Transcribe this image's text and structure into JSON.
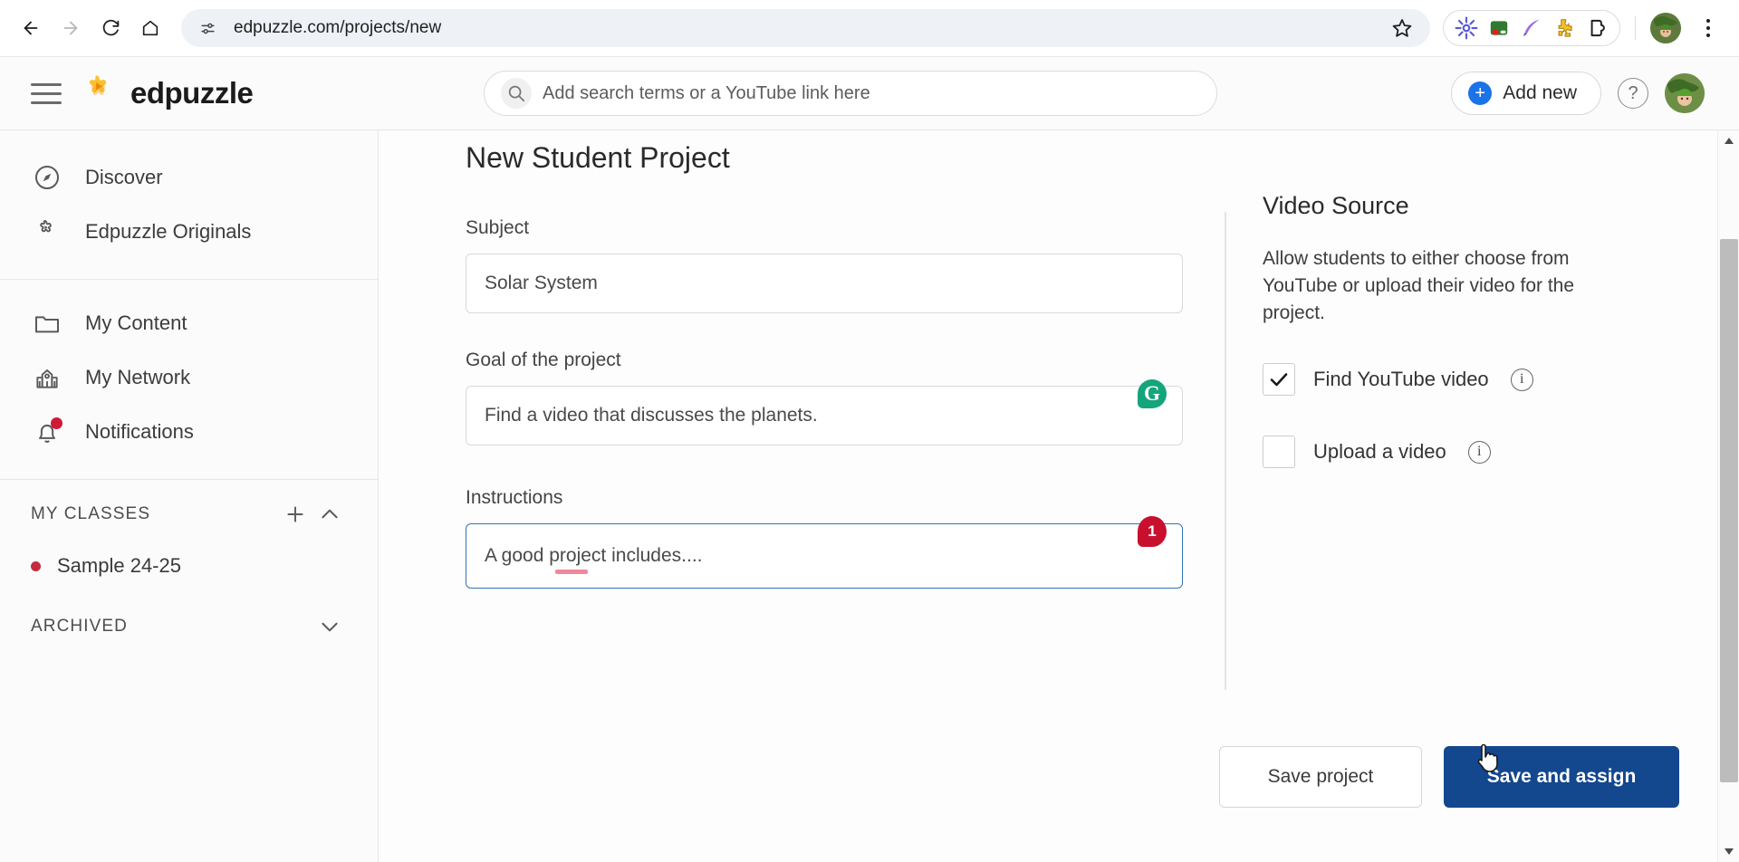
{
  "browser": {
    "back_icon": "back-arrow-icon",
    "forward_icon": "forward-arrow-icon",
    "reload_icon": "reload-icon",
    "home_icon": "home-icon",
    "site_info_icon": "site-settings-icon",
    "url": "edpuzzle.com/projects/new",
    "bookmark_icon": "star-icon",
    "extensions": [
      {
        "name": "extension-asterisk-icon",
        "color": "#5b5bd6"
      },
      {
        "name": "extension-screen-recorder-icon",
        "color": "#2f7a2f"
      },
      {
        "name": "extension-quill-icon",
        "color": "#8a5fd6"
      },
      {
        "name": "extension-puzzle-yellow-icon",
        "color": "#f5c026"
      },
      {
        "name": "extension-manager-icon",
        "color": "#1f1f1f"
      }
    ],
    "profile_icon": "browser-profile-avatar",
    "menu_icon": "three-dot-menu-icon"
  },
  "header": {
    "menu_icon": "hamburger-menu-icon",
    "logo_icon": "edpuzzle-logo-icon",
    "brand": "edpuzzle",
    "search": {
      "icon": "search-icon",
      "placeholder": "Add search terms or a YouTube link here",
      "value": ""
    },
    "add_new_label": "Add new",
    "help_label": "?",
    "avatar_icon": "user-avatar"
  },
  "sidebar": {
    "nav_top": [
      {
        "label": "Discover",
        "icon": "compass-icon"
      },
      {
        "label": "Edpuzzle Originals",
        "icon": "edpuzzle-puzzle-icon"
      }
    ],
    "nav_main": [
      {
        "label": "My Content",
        "icon": "folder-icon"
      },
      {
        "label": "My Network",
        "icon": "school-building-icon"
      },
      {
        "label": "Notifications",
        "icon": "bell-icon",
        "badge": true
      }
    ],
    "my_classes": {
      "title": "MY CLASSES",
      "add_icon": "plus-icon",
      "collapse_icon": "chevron-up-icon",
      "classes": [
        {
          "label": "Sample 24-25",
          "dot_color": "#c42b3f"
        }
      ]
    },
    "archived": {
      "title": "ARCHIVED",
      "expand_icon": "chevron-down-icon"
    }
  },
  "main": {
    "page_title": "New Student Project",
    "fields": [
      {
        "label": "Subject",
        "value": "Solar System",
        "focused": false,
        "badge": null
      },
      {
        "label": "Goal of the project",
        "value": "Find a video that discusses the planets.",
        "focused": false,
        "badge": "grammarly-logo-icon",
        "badge_text": "G"
      },
      {
        "label": "Instructions",
        "value": "A good project includes....",
        "focused": true,
        "badge": "grammarly-issue-count-badge",
        "badge_text": "1"
      }
    ],
    "video_source": {
      "title": "Video Source",
      "description": "Allow students to either choose from YouTube or upload their video for the project.",
      "options": [
        {
          "label": "Find YouTube video",
          "checked": true,
          "info_icon": "info-icon"
        },
        {
          "label": "Upload a video",
          "checked": false,
          "info_icon": "info-icon"
        }
      ]
    },
    "actions": {
      "secondary_label": "Save project",
      "primary_label": "Save and assign",
      "primary_color": "#13478e"
    }
  },
  "scrollbar": {
    "up_icon": "scroll-up-arrow-icon",
    "down_icon": "scroll-down-arrow-icon"
  }
}
